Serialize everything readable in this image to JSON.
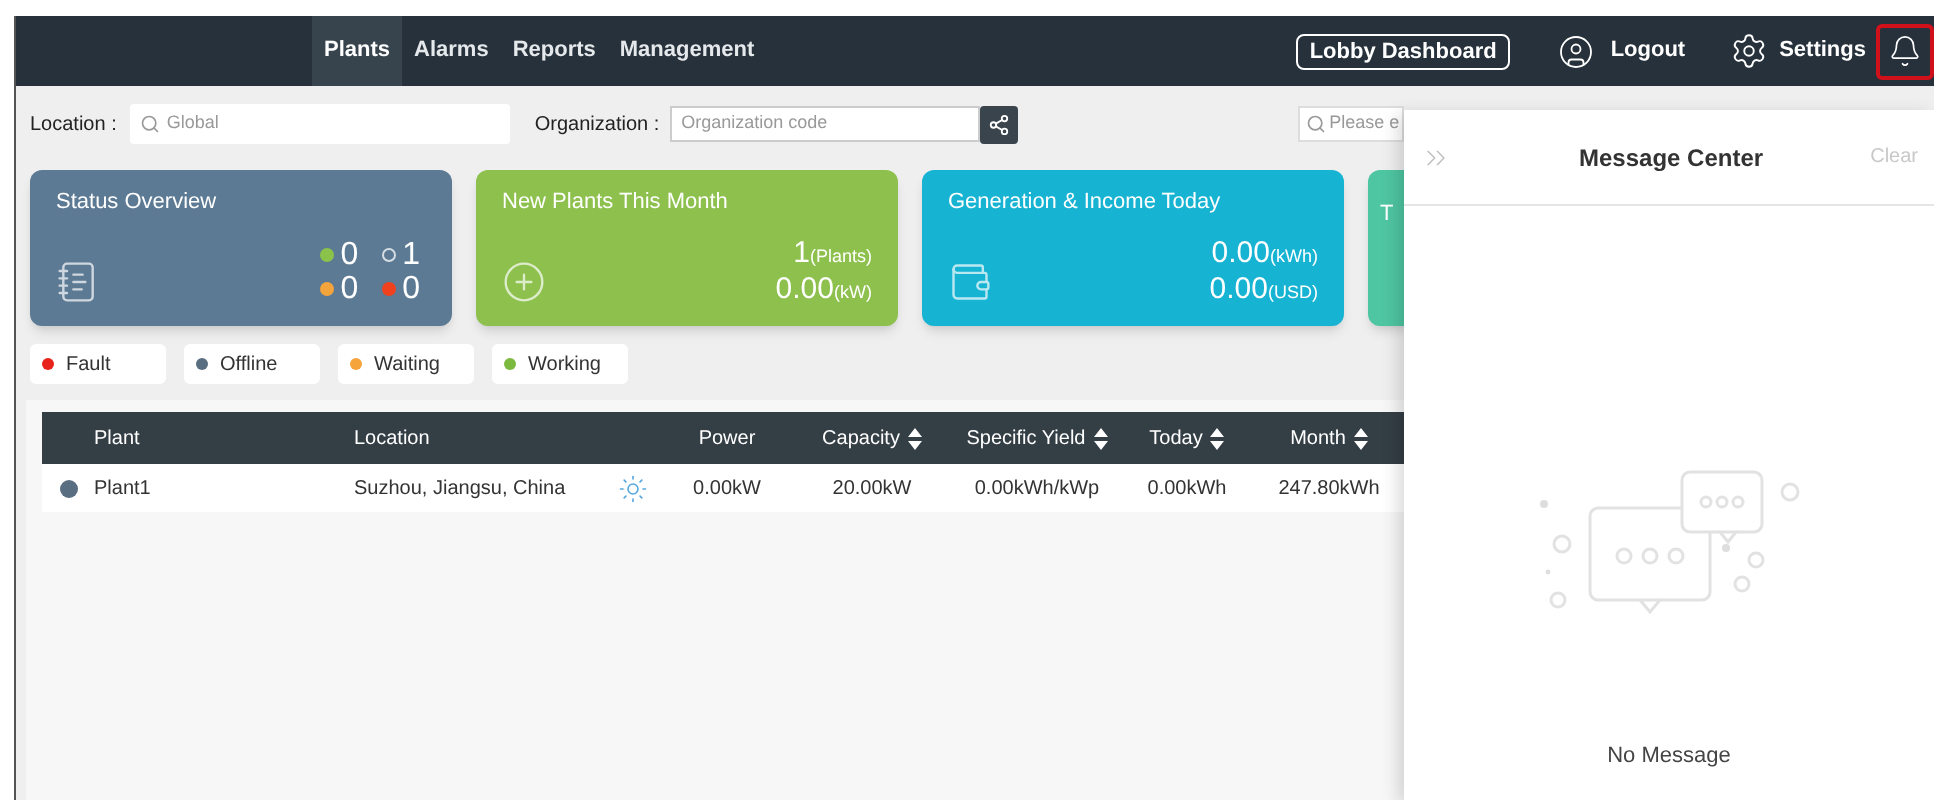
{
  "nav": {
    "items": [
      {
        "label": "Plants",
        "selected": true
      },
      {
        "label": "Alarms",
        "selected": false
      },
      {
        "label": "Reports",
        "selected": false
      },
      {
        "label": "Management",
        "selected": false
      }
    ],
    "lobby_button": "Lobby Dashboard",
    "logout": "Logout",
    "settings": "Settings",
    "bell_highlighted": true
  },
  "filters": {
    "location": {
      "label": "Location :",
      "placeholder": "Global"
    },
    "organization": {
      "label": "Organization :",
      "placeholder": "Organization code"
    },
    "search": {
      "placeholder": "Please e"
    }
  },
  "cards": [
    {
      "kind": "status",
      "title": "Status Overview",
      "color": "#5c7a94",
      "counts": [
        {
          "value": "0",
          "color": "#8bc34a",
          "hollow": false
        },
        {
          "value": "1",
          "color": "#d5dde4",
          "hollow": true
        },
        {
          "value": "0",
          "color": "#f5a33b",
          "hollow": false
        },
        {
          "value": "0",
          "color": "#f0411f",
          "hollow": false
        }
      ]
    },
    {
      "kind": "values",
      "title": "New Plants This Month",
      "color": "#8dc04d",
      "values": [
        {
          "value": "1",
          "unit": "(Plants)"
        },
        {
          "value": "0.00",
          "unit": "(kW)"
        }
      ]
    },
    {
      "kind": "values",
      "title": "Generation & Income Today",
      "color": "#17b3d3",
      "values": [
        {
          "value": "0.00",
          "unit": "(kWh)"
        },
        {
          "value": "0.00",
          "unit": "(USD)"
        }
      ]
    },
    {
      "kind": "partial",
      "title": "T",
      "color": "#4fc6a2"
    }
  ],
  "legend": [
    {
      "label": "Fault",
      "color": "#e8231b"
    },
    {
      "label": "Offline",
      "color": "#5a6e82"
    },
    {
      "label": "Waiting",
      "color": "#f5a33b"
    },
    {
      "label": "Working",
      "color": "#7cba3f"
    }
  ],
  "table": {
    "columns": [
      {
        "label": "Plant",
        "sortable": false
      },
      {
        "label": "Location",
        "sortable": false
      },
      {
        "label": "Power",
        "sortable": false
      },
      {
        "label": "Capacity",
        "sortable": true
      },
      {
        "label": "Specific Yield",
        "sortable": true
      },
      {
        "label": "Today",
        "sortable": true
      },
      {
        "label": "Month",
        "sortable": true
      }
    ],
    "rows": [
      {
        "color": "#5a6e82",
        "cells": [
          "Plant1",
          "Suzhou, Jiangsu, China",
          "0.00kW",
          "20.00kW",
          "0.00kWh/kWp",
          "0.00kWh",
          "247.80kWh"
        ]
      }
    ]
  },
  "message_center": {
    "title": "Message Center",
    "clear": "Clear",
    "empty_text": "No Message"
  }
}
